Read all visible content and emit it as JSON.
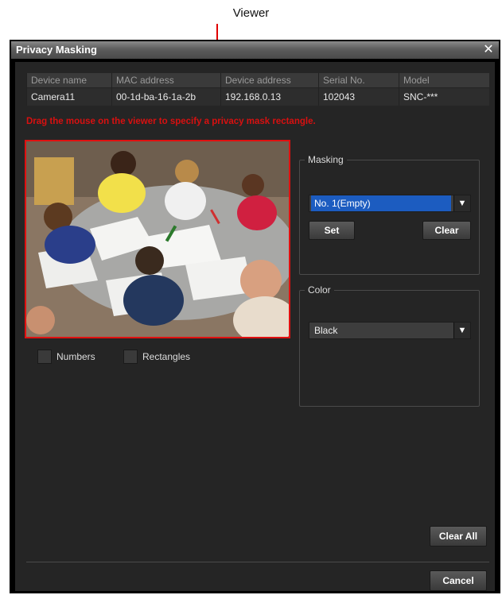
{
  "callout": {
    "label": "Viewer"
  },
  "window": {
    "title": "Privacy Masking",
    "close_glyph": "✕"
  },
  "device_table": {
    "columns": [
      "Device name",
      "MAC address",
      "Device address",
      "Serial No.",
      "Model"
    ],
    "rows": [
      [
        "Camera11",
        "00-1d-ba-16-1a-2b",
        "192.168.0.13",
        "102043",
        "SNC-***"
      ]
    ]
  },
  "instruction": "Drag the mouse on the viewer to specify a privacy mask rectangle.",
  "viewer": {
    "content": "camera-image"
  },
  "checkboxes": {
    "numbers": "Numbers",
    "rectangles": "Rectangles"
  },
  "masking": {
    "legend": "Masking",
    "selected": "No. 1(Empty)",
    "set_label": "Set",
    "clear_label": "Clear"
  },
  "color": {
    "legend": "Color",
    "selected": "Black"
  },
  "footer": {
    "clear_all_label": "Clear All",
    "cancel_label": "Cancel"
  },
  "colors": {
    "accent_red": "#e01010",
    "selection_blue": "#1c5cc0",
    "background": "#252525"
  }
}
